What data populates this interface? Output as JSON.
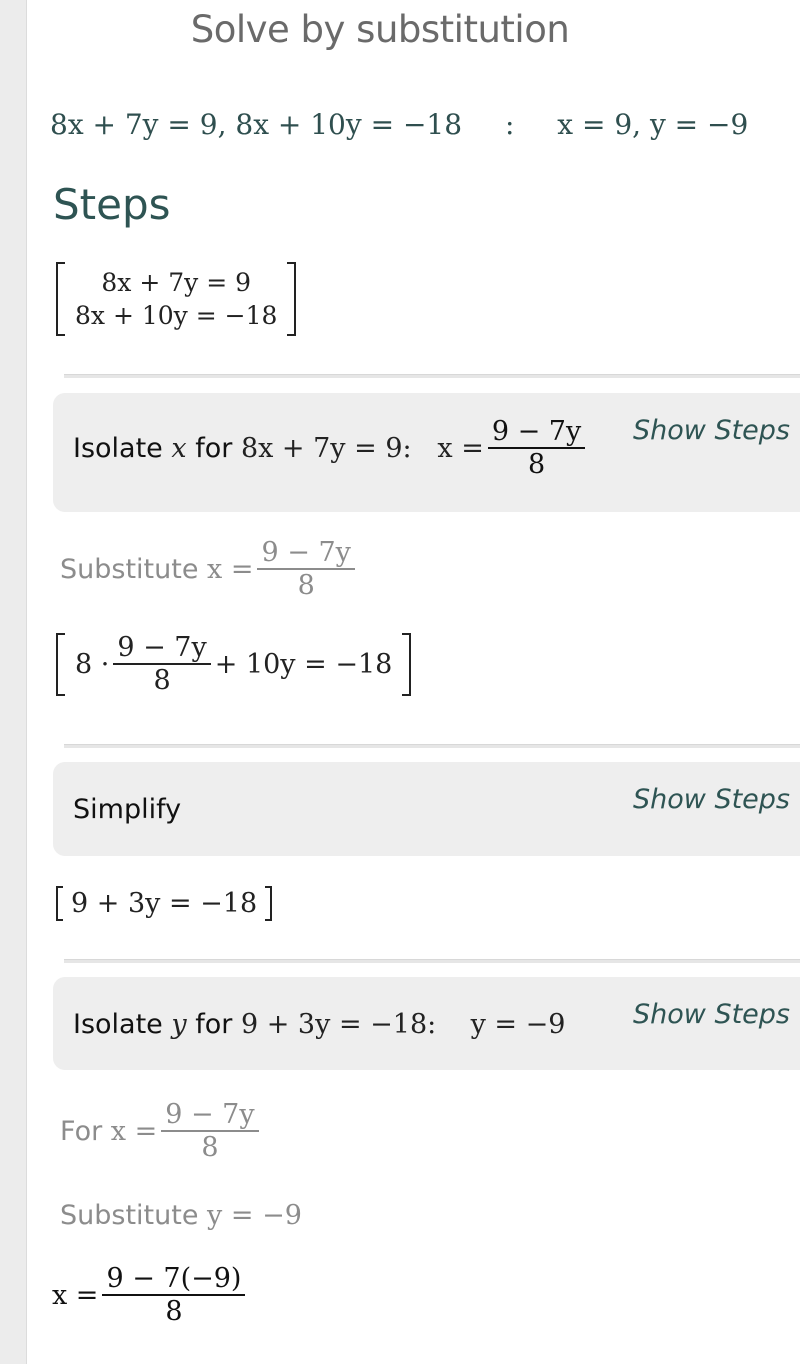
{
  "page": {
    "title": "Solve by substitution"
  },
  "problem": {
    "equations": "8x + 7y = 9, 8x + 10y = −18",
    "separator": ":",
    "solution": "x = 9, y = −9"
  },
  "steps_heading": "Steps",
  "system": {
    "line1": "8x + 7y = 9",
    "line2": "8x + 10y = −18"
  },
  "step1": {
    "prefix": "Isolate",
    "var": "x",
    "for_word": "for",
    "equation": "8x + 7y = 9:",
    "result_lhs": "x =",
    "result_num": "9 − 7y",
    "result_den": "8",
    "show_steps": "Show Steps"
  },
  "substitute1": {
    "label": "Substitute",
    "lhs": "x =",
    "num": "9 − 7y",
    "den": "8"
  },
  "substituted_equation": {
    "coef": "8 ·",
    "num": "9 − 7y",
    "den": "8",
    "rest": "+ 10y = −18"
  },
  "step2": {
    "label": "Simplify",
    "show_steps": "Show Steps"
  },
  "simplified_equation": "9 + 3y = −18",
  "step3": {
    "prefix": "Isolate",
    "var": "y",
    "for_word": "for",
    "equation": "9 + 3y = −18:",
    "result": "y = −9",
    "show_steps": "Show Steps"
  },
  "for_x": {
    "label": "For",
    "lhs": "x =",
    "num": "9 − 7y",
    "den": "8"
  },
  "substitute2": {
    "label": "Substitute",
    "expr": "y = −9"
  },
  "final_expression": {
    "lhs": "x =",
    "num": "9 − 7(−9)",
    "den": "8"
  }
}
